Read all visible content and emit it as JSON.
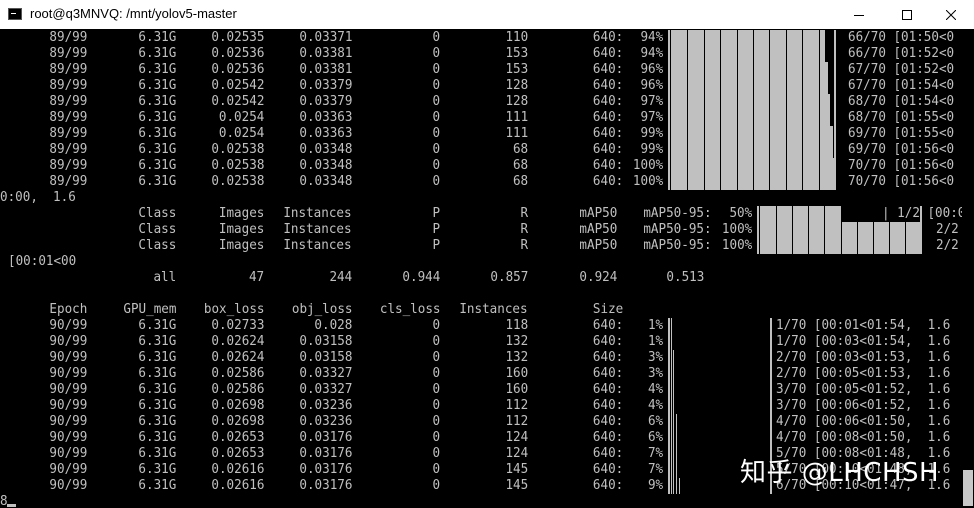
{
  "window": {
    "title": "root@q3MNVQ: /mnt/yolov5-master",
    "minimize_glyph": "minimize",
    "maximize_glyph": "maximize",
    "close_glyph": "close"
  },
  "epoch89_rows": [
    {
      "epoch": "89/99",
      "gpu_mem": "6.31G",
      "box_loss": "0.02535",
      "obj_loss": "0.03371",
      "cls_loss": "0",
      "instances": "110",
      "size": "640:",
      "pct": "94%",
      "progress": "66/70 [01:50<0",
      "fill_fraction": 0.94
    },
    {
      "epoch": "89/99",
      "gpu_mem": "6.31G",
      "box_loss": "0.02536",
      "obj_loss": "0.03381",
      "cls_loss": "0",
      "instances": "153",
      "size": "640:",
      "pct": "94%",
      "progress": "66/70 [01:52<0",
      "fill_fraction": 0.94
    },
    {
      "epoch": "89/99",
      "gpu_mem": "6.31G",
      "box_loss": "0.02536",
      "obj_loss": "0.03381",
      "cls_loss": "0",
      "instances": "153",
      "size": "640:",
      "pct": "96%",
      "progress": "67/70 [01:52<0",
      "fill_fraction": 0.96
    },
    {
      "epoch": "89/99",
      "gpu_mem": "6.31G",
      "box_loss": "0.02542",
      "obj_loss": "0.03379",
      "cls_loss": "0",
      "instances": "128",
      "size": "640:",
      "pct": "96%",
      "progress": "67/70 [01:54<0",
      "fill_fraction": 0.96
    },
    {
      "epoch": "89/99",
      "gpu_mem": "6.31G",
      "box_loss": "0.02542",
      "obj_loss": "0.03379",
      "cls_loss": "0",
      "instances": "128",
      "size": "640:",
      "pct": "97%",
      "progress": "68/70 [01:54<0",
      "fill_fraction": 0.97
    },
    {
      "epoch": "89/99",
      "gpu_mem": "6.31G",
      "box_loss": "0.0254",
      "obj_loss": "0.03363",
      "cls_loss": "0",
      "instances": "111",
      "size": "640:",
      "pct": "97%",
      "progress": "68/70 [01:55<0",
      "fill_fraction": 0.97
    },
    {
      "epoch": "89/99",
      "gpu_mem": "6.31G",
      "box_loss": "0.0254",
      "obj_loss": "0.03363",
      "cls_loss": "0",
      "instances": "111",
      "size": "640:",
      "pct": "99%",
      "progress": "69/70 [01:55<0",
      "fill_fraction": 0.99
    },
    {
      "epoch": "89/99",
      "gpu_mem": "6.31G",
      "box_loss": "0.02538",
      "obj_loss": "0.03348",
      "cls_loss": "0",
      "instances": "68",
      "size": "640:",
      "pct": "99%",
      "progress": "69/70 [01:56<0",
      "fill_fraction": 0.99
    },
    {
      "epoch": "89/99",
      "gpu_mem": "6.31G",
      "box_loss": "0.02538",
      "obj_loss": "0.03348",
      "cls_loss": "0",
      "instances": "68",
      "size": "640:",
      "pct": "100%",
      "progress": "70/70 [01:56<0",
      "fill_fraction": 1.0
    },
    {
      "epoch": "89/99",
      "gpu_mem": "6.31G",
      "box_loss": "0.02538",
      "obj_loss": "0.03348",
      "cls_loss": "0",
      "instances": "68",
      "size": "640:",
      "pct": "100%",
      "progress": "70/70 [01:56<0",
      "fill_fraction": 1.0
    }
  ],
  "wrap_line_1": "0:00,  1.6",
  "val_rows": [
    {
      "class": "Class",
      "images": "Images",
      "instances": "Instances",
      "p": "P",
      "r": "R",
      "map50": "mAP50",
      "map50_95": "mAP50-95:",
      "pct": "50%",
      "progress": "| 1/2 [00:0",
      "fill_fraction": 0.5
    },
    {
      "class": "Class",
      "images": "Images",
      "instances": "Instances",
      "p": "P",
      "r": "R",
      "map50": "mAP50",
      "map50_95": "mAP50-95:",
      "pct": "100%",
      "progress": "2/2",
      "fill_fraction": 1.0
    },
    {
      "class": "Class",
      "images": "Images",
      "instances": "Instances",
      "p": "P",
      "r": "R",
      "map50": "mAP50",
      "map50_95": "mAP50-95:",
      "pct": "100%",
      "progress": "2/2",
      "fill_fraction": 1.0
    }
  ],
  "wrap_line_2": "[00:01<00",
  "summary": {
    "class": "all",
    "images": "47",
    "instances": "244",
    "p": "0.944",
    "r": "0.857",
    "map50": "0.924",
    "map50_95": "0.513"
  },
  "header": {
    "epoch": "Epoch",
    "gpu_mem": "GPU_mem",
    "box_loss": "box_loss",
    "obj_loss": "obj_loss",
    "cls_loss": "cls_loss",
    "instances": "Instances",
    "size": "Size"
  },
  "epoch90_rows": [
    {
      "epoch": "90/99",
      "gpu_mem": "6.31G",
      "box_loss": "0.02733",
      "obj_loss": "0.028",
      "cls_loss": "0",
      "instances": "118",
      "size": "640:",
      "pct": "1%",
      "progress": "1/70 [00:01<01:54,  1.6",
      "fill_fraction": 0.01
    },
    {
      "epoch": "90/99",
      "gpu_mem": "6.31G",
      "box_loss": "0.02624",
      "obj_loss": "0.03158",
      "cls_loss": "0",
      "instances": "132",
      "size": "640:",
      "pct": "1%",
      "progress": "1/70 [00:03<01:54,  1.6",
      "fill_fraction": 0.01
    },
    {
      "epoch": "90/99",
      "gpu_mem": "6.31G",
      "box_loss": "0.02624",
      "obj_loss": "0.03158",
      "cls_loss": "0",
      "instances": "132",
      "size": "640:",
      "pct": "3%",
      "progress": "2/70 [00:03<01:53,  1.6",
      "fill_fraction": 0.03
    },
    {
      "epoch": "90/99",
      "gpu_mem": "6.31G",
      "box_loss": "0.02586",
      "obj_loss": "0.03327",
      "cls_loss": "0",
      "instances": "160",
      "size": "640:",
      "pct": "3%",
      "progress": "2/70 [00:05<01:53,  1.6",
      "fill_fraction": 0.03
    },
    {
      "epoch": "90/99",
      "gpu_mem": "6.31G",
      "box_loss": "0.02586",
      "obj_loss": "0.03327",
      "cls_loss": "0",
      "instances": "160",
      "size": "640:",
      "pct": "4%",
      "progress": "3/70 [00:05<01:52,  1.6",
      "fill_fraction": 0.04
    },
    {
      "epoch": "90/99",
      "gpu_mem": "6.31G",
      "box_loss": "0.02698",
      "obj_loss": "0.03236",
      "cls_loss": "0",
      "instances": "112",
      "size": "640:",
      "pct": "4%",
      "progress": "3/70 [00:06<01:52,  1.6",
      "fill_fraction": 0.04
    },
    {
      "epoch": "90/99",
      "gpu_mem": "6.31G",
      "box_loss": "0.02698",
      "obj_loss": "0.03236",
      "cls_loss": "0",
      "instances": "112",
      "size": "640:",
      "pct": "6%",
      "progress": "4/70 [00:06<01:50,  1.6",
      "fill_fraction": 0.06
    },
    {
      "epoch": "90/99",
      "gpu_mem": "6.31G",
      "box_loss": "0.02653",
      "obj_loss": "0.03176",
      "cls_loss": "0",
      "instances": "124",
      "size": "640:",
      "pct": "6%",
      "progress": "4/70 [00:08<01:50,  1.6",
      "fill_fraction": 0.06
    },
    {
      "epoch": "90/99",
      "gpu_mem": "6.31G",
      "box_loss": "0.02653",
      "obj_loss": "0.03176",
      "cls_loss": "0",
      "instances": "124",
      "size": "640:",
      "pct": "7%",
      "progress": "5/70 [00:08<01:48,  1.6",
      "fill_fraction": 0.07
    },
    {
      "epoch": "90/99",
      "gpu_mem": "6.31G",
      "box_loss": "0.02616",
      "obj_loss": "0.03176",
      "cls_loss": "0",
      "instances": "145",
      "size": "640:",
      "pct": "7%",
      "progress": "5/70 [00:10<01:48,  1.6",
      "fill_fraction": 0.07
    },
    {
      "epoch": "90/99",
      "gpu_mem": "6.31G",
      "box_loss": "0.02616",
      "obj_loss": "0.03176",
      "cls_loss": "0",
      "instances": "145",
      "size": "640:",
      "pct": "9%",
      "progress": "6/70 [00:10<01:47,  1.6",
      "fill_fraction": 0.09
    }
  ],
  "prompt_line": "8",
  "watermark": "知乎 @LHCHSH",
  "colors": {
    "terminal_bg": "#000000",
    "terminal_fg": "#c0c0c0",
    "titlebar_bg": "#ffffff"
  }
}
